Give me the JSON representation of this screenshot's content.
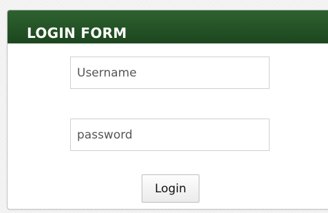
{
  "login_form": {
    "title": "LOGIN FORM",
    "username": {
      "placeholder": "Username",
      "value": ""
    },
    "password": {
      "placeholder": "password",
      "value": ""
    },
    "submit_label": "Login"
  },
  "colors": {
    "header_green": "#245326",
    "panel_background": "#ffffff",
    "page_background": "#f4f4f4"
  }
}
